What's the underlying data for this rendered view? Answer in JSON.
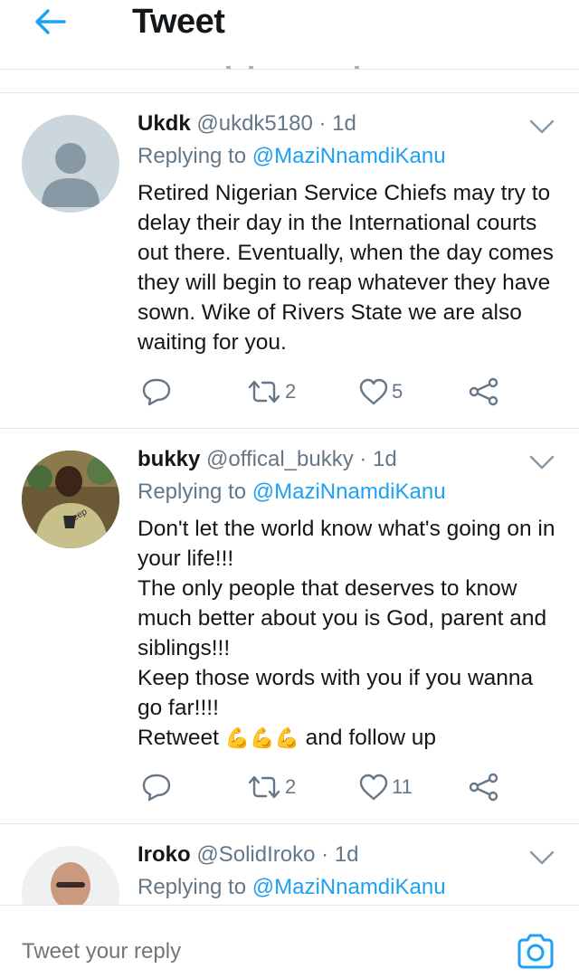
{
  "header": {
    "title": "Tweet"
  },
  "tweets": [
    {
      "name": "Ukdk",
      "handle": "@ukdk5180",
      "dot": " · ",
      "time": "1d",
      "replying_prefix": "Replying to ",
      "replying_to": "@MaziNnamdiKanu",
      "body": "Retired Nigerian Service Chiefs may try to delay their day in the International courts out there. Eventually, when the day comes they will begin to reap whatever they have sown. Wike of Rivers State we are also waiting for you.",
      "retweets": "2",
      "likes": "5"
    },
    {
      "name": "bukky",
      "handle": "@offical_bukky",
      "dot": " · ",
      "time": "1d",
      "replying_prefix": "Replying to ",
      "replying_to": "@MaziNnamdiKanu",
      "body_lines": [
        "Don't let the world know what's going on in your life!!!",
        "The only people that deserves to know much better about you is God, parent and siblings!!!",
        "Keep those words with you if you wanna go far!!!!"
      ],
      "body_last_prefix": "Retweet ",
      "body_last_emoji": "💪💪💪",
      "body_last_suffix": " and follow up",
      "retweets": "2",
      "likes": "11"
    },
    {
      "name": "Iroko",
      "handle": "@SolidIroko",
      "dot": " · ",
      "time": "1d",
      "replying_prefix": "Replying to ",
      "replying_to": "@MaziNnamdiKanu"
    }
  ],
  "reply_bar": {
    "placeholder": "Tweet your reply"
  },
  "colors": {
    "accent": "#1da1f2",
    "secondary_text": "#657786",
    "divider": "#e1e8ed",
    "primary_text": "#14171a"
  }
}
